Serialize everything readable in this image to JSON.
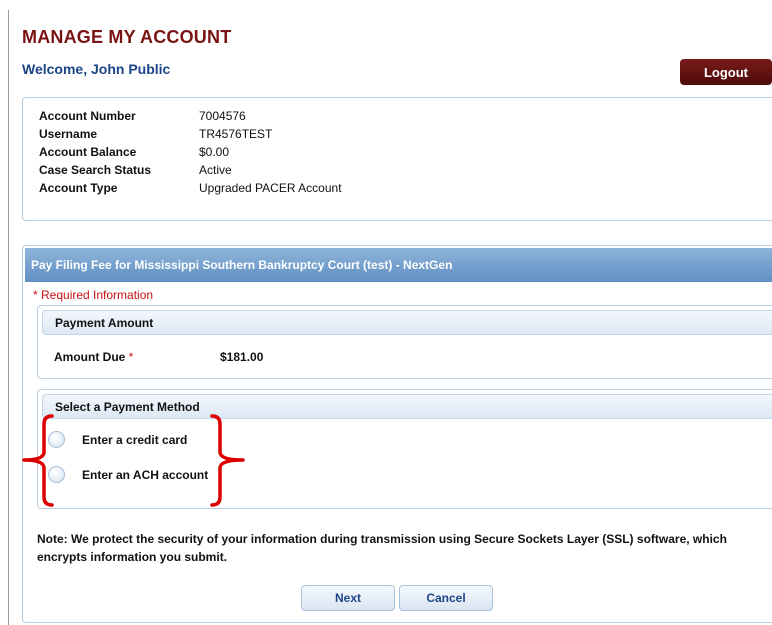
{
  "page": {
    "title": "MANAGE MY ACCOUNT",
    "welcome": "Welcome, John Public",
    "logout_label": "Logout"
  },
  "account": {
    "rows": [
      {
        "label": "Account Number",
        "value": "7004576"
      },
      {
        "label": "Username",
        "value": "TR4576TEST"
      },
      {
        "label": "Account Balance",
        "value": "$0.00"
      },
      {
        "label": "Case Search Status",
        "value": "Active"
      },
      {
        "label": "Account Type",
        "value": "Upgraded PACER Account"
      }
    ]
  },
  "payment": {
    "header": "Pay Filing Fee for Mississippi Southern Bankruptcy Court (test) - NextGen",
    "required_note": "* Required Information",
    "amount_section": {
      "title": "Payment Amount",
      "label": "Amount Due",
      "required_marker": "*",
      "value": "$181.00"
    },
    "method_section": {
      "title": "Select a Payment Method",
      "options": [
        {
          "label": "Enter a credit card"
        },
        {
          "label": "Enter an ACH account"
        }
      ]
    },
    "security_note": "Note: We protect the security of your information during transmission using Secure Sockets Layer (SSL) software, which encrypts information you submit.",
    "buttons": {
      "next": "Next",
      "cancel": "Cancel"
    }
  },
  "colors": {
    "title": "#7a1414",
    "welcome": "#1c4587",
    "logout_bg": "#5a1010",
    "header_bg": "#6f9bcb",
    "required": "#cc1111",
    "annotation_brace": "#dd0000"
  }
}
